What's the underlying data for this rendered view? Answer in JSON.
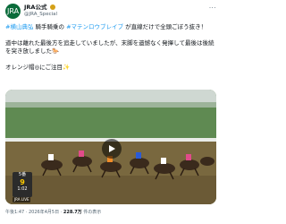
{
  "author": {
    "name": "JRA公式",
    "handle": "@JRA_Special",
    "avatar_text": "JRA"
  },
  "body": {
    "line1_tag1": "#横山典弘",
    "line1_mid": " 騎手騎乗の ",
    "line1_tag2": "#マテンロウブレイブ",
    "line1_end": " が直線だけで全頭ごぼう抜き！",
    "line2": "道中は離れた最後方を追走していましたが、末脚を遺憾なく発揮して最後は後続を突き放しました🐎",
    "line3": "オレンジ帽◎にご注目✨"
  },
  "media": {
    "badge_top": "5番",
    "badge_big": "9",
    "badge_bottom": "1:02",
    "timer": "JRA LIVE"
  },
  "footer": {
    "time": "午後1:47 · 2026年4月5日 · ",
    "views": "228.7万",
    "views_label": " 件の表示"
  }
}
